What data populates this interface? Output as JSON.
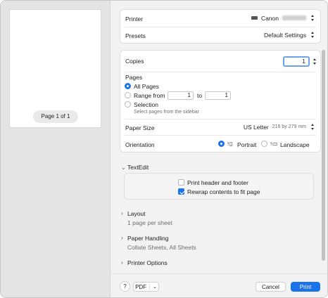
{
  "preview": {
    "page_indicator": "Page 1 of 1"
  },
  "printer": {
    "label": "Printer",
    "value": "Canon"
  },
  "presets": {
    "label": "Presets",
    "value": "Default Settings"
  },
  "copies": {
    "label": "Copies",
    "value": "1"
  },
  "pages": {
    "label": "Pages",
    "all_pages": "All Pages",
    "range_from": "Range from",
    "range_start": "1",
    "range_to": "to",
    "range_end": "1",
    "selection": "Selection",
    "selection_hint": "Select pages from the sidebar"
  },
  "paper_size": {
    "label": "Paper Size",
    "value": "US Letter",
    "dimensions": "216 by 279 mm"
  },
  "orientation": {
    "label": "Orientation",
    "portrait": "Portrait",
    "landscape": "Landscape"
  },
  "textedit": {
    "title": "TextEdit",
    "print_header_footer": "Print header and footer",
    "rewrap": "Rewrap contents to fit page"
  },
  "layout": {
    "title": "Layout",
    "subtitle": "1 page per sheet"
  },
  "paper_handling": {
    "title": "Paper Handling",
    "subtitle": "Collate Sheets, All Sheets"
  },
  "printer_options": {
    "title": "Printer Options"
  },
  "footer": {
    "help": "?",
    "pdf": "PDF",
    "cancel": "Cancel",
    "print": "Print"
  },
  "colors": {
    "accent": "#1a73e8",
    "focus_ring": "#6ea2e6"
  }
}
